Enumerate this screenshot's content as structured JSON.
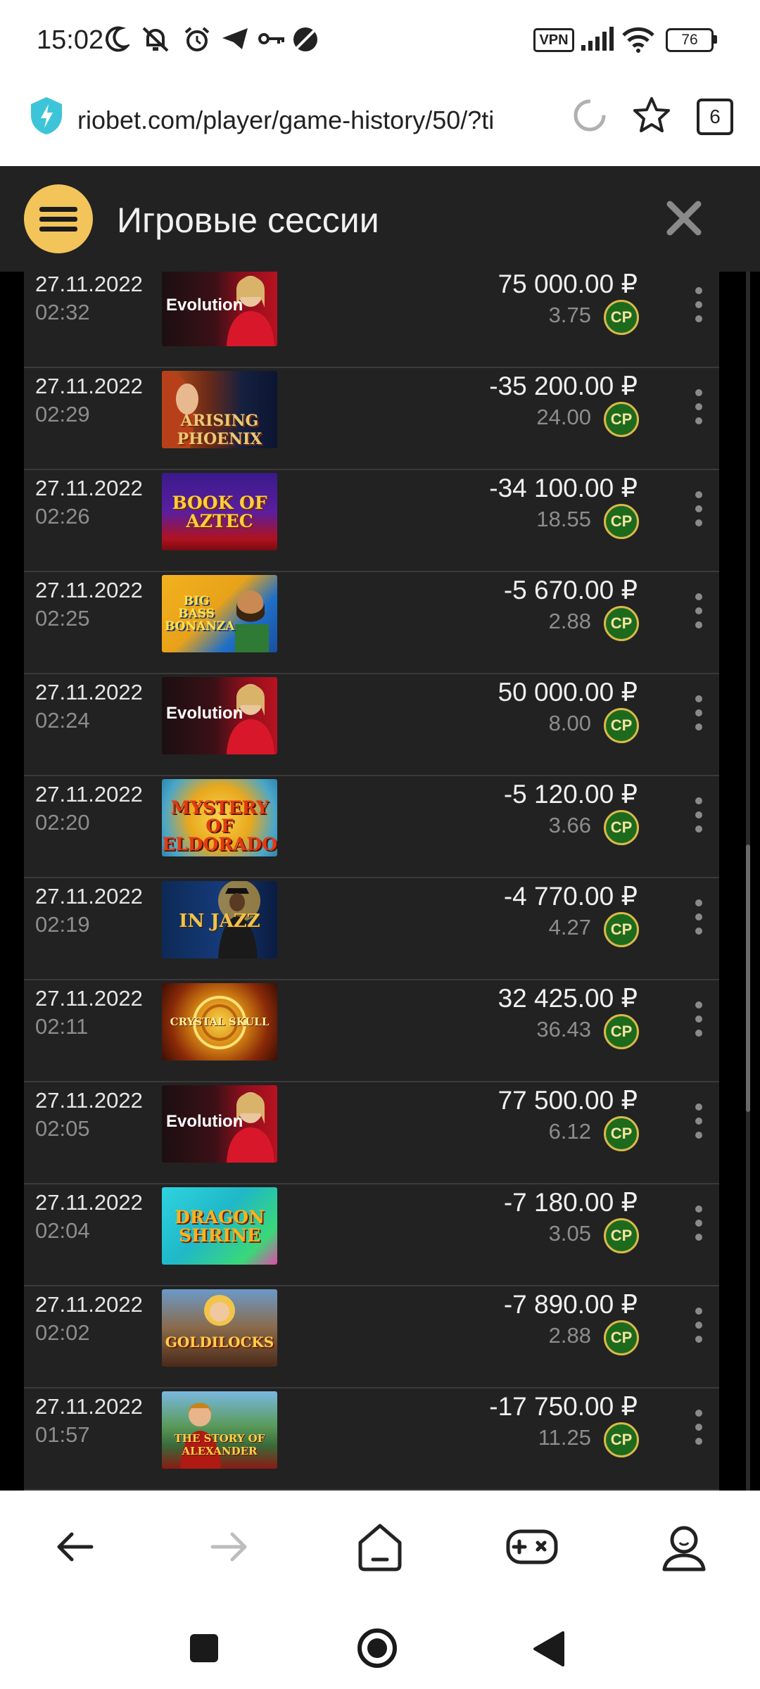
{
  "status_bar": {
    "time": "15:02",
    "vpn_label": "VPN",
    "battery": "76",
    "icons": [
      "moon-icon",
      "mute-icon",
      "alarm-icon",
      "telegram-icon",
      "key-icon",
      "blocked-icon",
      "vpn-icon",
      "signal-icon",
      "wifi-icon",
      "battery-icon"
    ]
  },
  "browser": {
    "url": "riobet.com/player/game-history/50/?ti",
    "tabs_count": "6"
  },
  "header": {
    "title": "Игровые сессии"
  },
  "currency": "₽",
  "points_badge": "CP",
  "sessions": [
    {
      "date": "27.11.2022",
      "time": "02:32",
      "game": "Evolution",
      "amount": "75 000.00 ₽",
      "points": "3.75"
    },
    {
      "date": "27.11.2022",
      "time": "02:29",
      "game": "ARISING PHOENIX",
      "amount": "-35 200.00 ₽",
      "points": "24.00"
    },
    {
      "date": "27.11.2022",
      "time": "02:26",
      "game": "BOOK OF AZTEC",
      "amount": "-34 100.00 ₽",
      "points": "18.55"
    },
    {
      "date": "27.11.2022",
      "time": "02:25",
      "game": "BIG BASS BONANZA",
      "amount": "-5 670.00 ₽",
      "points": "2.88"
    },
    {
      "date": "27.11.2022",
      "time": "02:24",
      "game": "Evolution",
      "amount": "50 000.00 ₽",
      "points": "8.00"
    },
    {
      "date": "27.11.2022",
      "time": "02:20",
      "game": "MYSTERY OF ELDORADO",
      "amount": "-5 120.00 ₽",
      "points": "3.66"
    },
    {
      "date": "27.11.2022",
      "time": "02:19",
      "game": "IN JAZZ",
      "amount": "-4 770.00 ₽",
      "points": "4.27"
    },
    {
      "date": "27.11.2022",
      "time": "02:11",
      "game": "CRYSTAL SKULL",
      "amount": "32 425.00 ₽",
      "points": "36.43"
    },
    {
      "date": "27.11.2022",
      "time": "02:05",
      "game": "Evolution",
      "amount": "77 500.00 ₽",
      "points": "6.12"
    },
    {
      "date": "27.11.2022",
      "time": "02:04",
      "game": "DRAGON SHRINE",
      "amount": "-7 180.00 ₽",
      "points": "3.05"
    },
    {
      "date": "27.11.2022",
      "time": "02:02",
      "game": "GOLDILOCKS",
      "amount": "-7 890.00 ₽",
      "points": "2.88"
    },
    {
      "date": "27.11.2022",
      "time": "01:57",
      "game": "THE STORY OF ALEXANDER",
      "amount": "-17 750.00 ₽",
      "points": "11.25"
    }
  ],
  "bottom_nav": [
    "back-icon",
    "forward-icon",
    "home-icon",
    "games-icon",
    "profile-icon"
  ],
  "system_nav": [
    "recents-icon",
    "home-circle-icon",
    "back-triangle-icon"
  ],
  "colors": {
    "accent": "#f2c45a",
    "background": "#222222",
    "badge_green": "#1d6a1d",
    "badge_border": "#d9b94a"
  }
}
